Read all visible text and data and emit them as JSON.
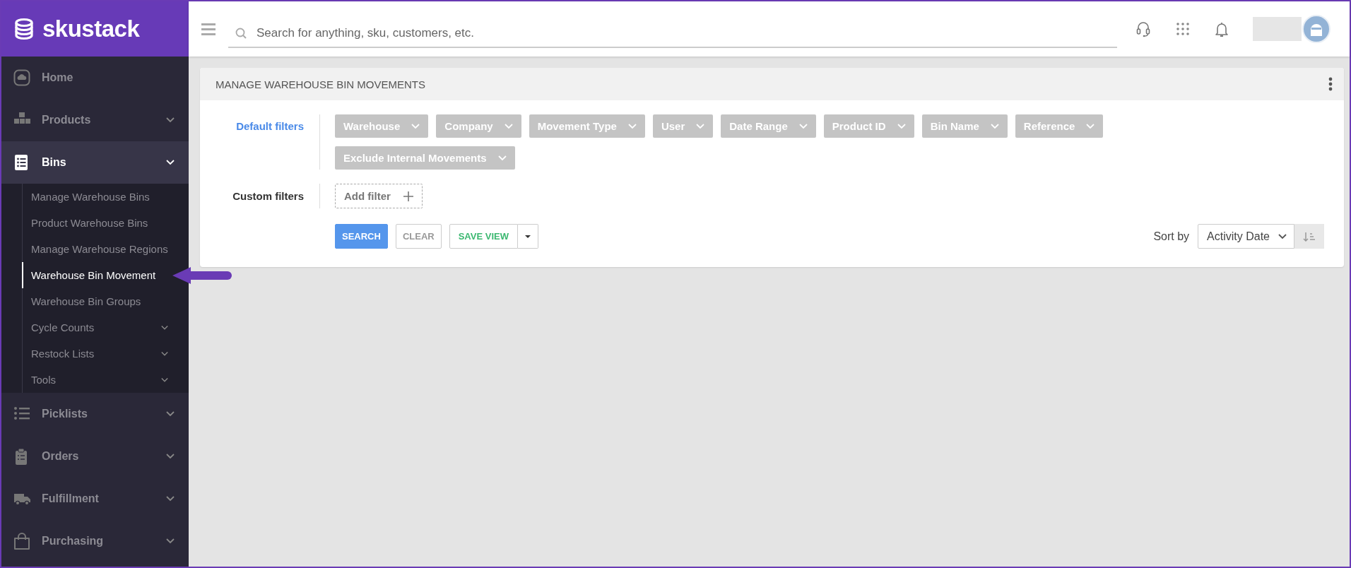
{
  "brand": {
    "name": "skustack"
  },
  "topbar": {
    "search_placeholder": "Search for anything, sku, customers, etc."
  },
  "sidebar": {
    "items": [
      {
        "label": "Home",
        "has_submenu": false,
        "expanded": false
      },
      {
        "label": "Products",
        "has_submenu": true,
        "expanded": false
      },
      {
        "label": "Bins",
        "has_submenu": true,
        "expanded": true,
        "children": [
          {
            "label": "Manage Warehouse Bins",
            "selected": false,
            "has_submenu": false
          },
          {
            "label": "Product Warehouse Bins",
            "selected": false,
            "has_submenu": false
          },
          {
            "label": "Manage Warehouse Regions",
            "selected": false,
            "has_submenu": false
          },
          {
            "label": "Warehouse Bin Movement",
            "selected": true,
            "has_submenu": false
          },
          {
            "label": "Warehouse Bin Groups",
            "selected": false,
            "has_submenu": false
          },
          {
            "label": "Cycle Counts",
            "selected": false,
            "has_submenu": true
          },
          {
            "label": "Restock Lists",
            "selected": false,
            "has_submenu": true
          },
          {
            "label": "Tools",
            "selected": false,
            "has_submenu": true
          }
        ]
      },
      {
        "label": "Picklists",
        "has_submenu": true,
        "expanded": false
      },
      {
        "label": "Orders",
        "has_submenu": true,
        "expanded": false
      },
      {
        "label": "Fulfillment",
        "has_submenu": true,
        "expanded": false
      },
      {
        "label": "Purchasing",
        "has_submenu": true,
        "expanded": false
      }
    ]
  },
  "card": {
    "title": "MANAGE WAREHOUSE BIN MOVEMENTS",
    "default_filters": {
      "label": "Default filters",
      "chips": [
        "Warehouse",
        "Company",
        "Movement Type",
        "User",
        "Date Range",
        "Product ID",
        "Bin Name",
        "Reference",
        "Exclude Internal Movements"
      ]
    },
    "custom_filters": {
      "label": "Custom filters",
      "add_filter": "Add filter"
    },
    "buttons": {
      "search": "SEARCH",
      "clear": "CLEAR",
      "save_view": "SAVE VIEW"
    },
    "sort": {
      "label": "Sort by",
      "value": "Activity Date"
    }
  }
}
